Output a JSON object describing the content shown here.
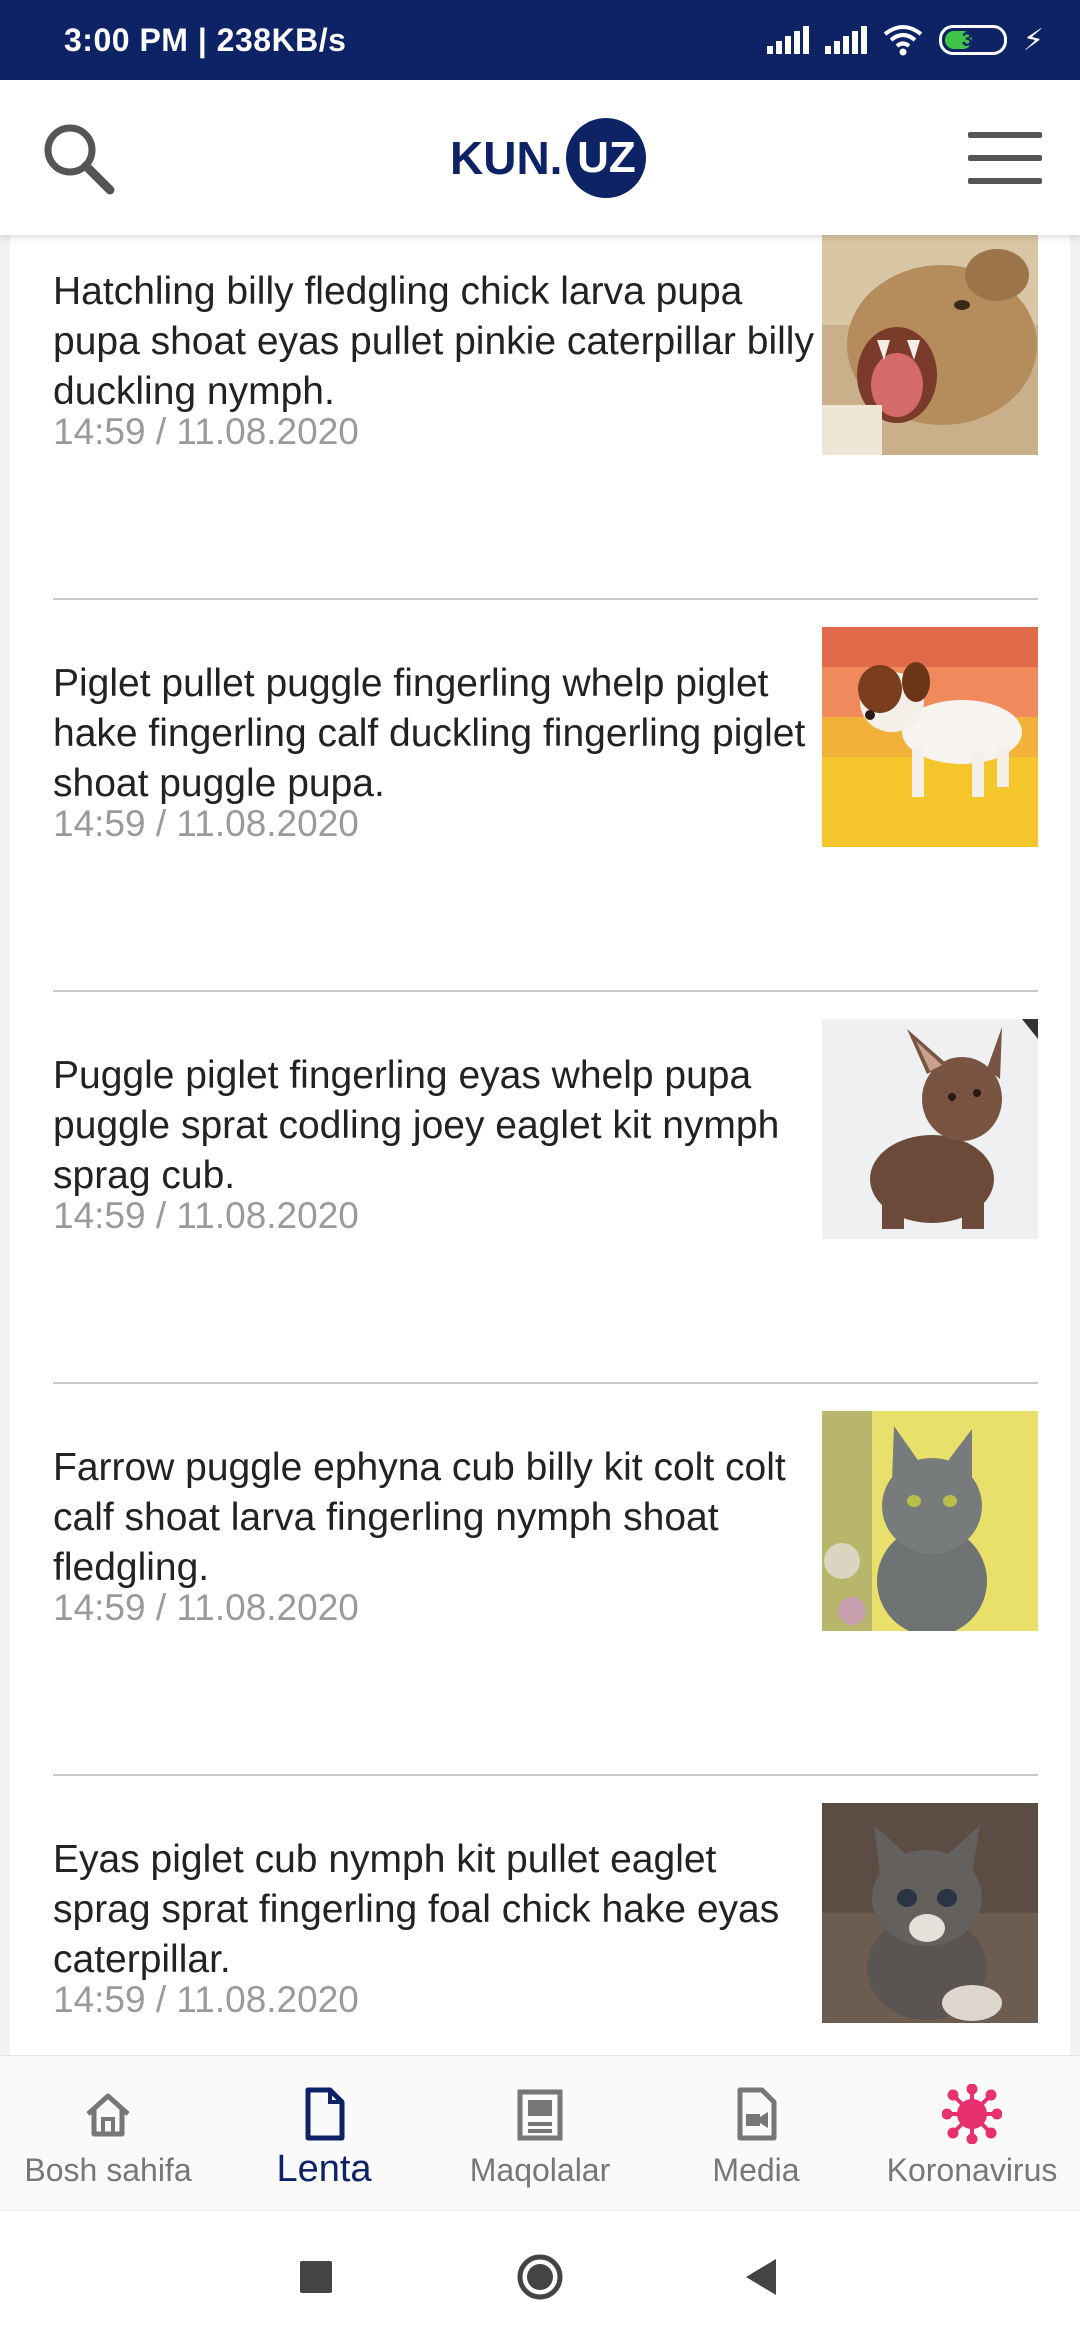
{
  "status_bar": {
    "time_speed": "3:00 PM | 238KB/s",
    "battery_level": "39"
  },
  "header": {
    "logo_text": "KUN.",
    "logo_badge": "UZ",
    "brand_color": "#0e2266"
  },
  "news": [
    {
      "title": "Hatchling billy fledgling chick larva pupa pupa shoat eyas pullet pinkie caterpillar billy duckling nymph.",
      "date": "14:59 / 11.08.2020",
      "image": "lion-cub-roaring"
    },
    {
      "title": "Piglet pullet puggle fingerling whelp piglet hake fingerling calf duckling fingerling piglet shoat puggle pupa.",
      "date": "14:59 / 11.08.2020",
      "image": "puppy-on-yellow"
    },
    {
      "title": "Puggle piglet fingerling eyas whelp pupa puggle sprat codling joey eaglet kit nymph sprag cub.",
      "date": "14:59 / 11.08.2020",
      "image": "brown-kitten"
    },
    {
      "title": "Farrow puggle ephyna cub billy kit colt colt calf shoat larva fingerling nymph shoat fledgling.",
      "date": "14:59 / 11.08.2020",
      "image": "grey-kitten"
    },
    {
      "title": "Eyas piglet cub nymph kit pullet eaglet sprag sprat fingerling foal chick hake eyas caterpillar.",
      "date": "14:59 / 11.08.2020",
      "image": "tabby-kitten"
    }
  ],
  "bottom_nav": [
    {
      "label": "Bosh sahifa",
      "icon": "home-icon"
    },
    {
      "label": "Lenta",
      "icon": "document-icon",
      "active": true
    },
    {
      "label": "Maqolalar",
      "icon": "article-icon"
    },
    {
      "label": "Media",
      "icon": "media-icon"
    },
    {
      "label": "Koronavirus",
      "icon": "virus-icon",
      "color": "#e8306e"
    }
  ]
}
